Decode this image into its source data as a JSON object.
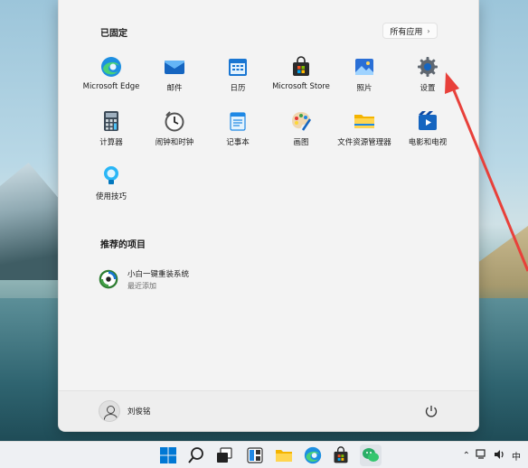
{
  "start_menu": {
    "pinned_title": "已固定",
    "all_apps_label": "所有应用",
    "pinned_apps": [
      {
        "label": "Microsoft Edge",
        "icon": "edge-icon"
      },
      {
        "label": "邮件",
        "icon": "mail-icon"
      },
      {
        "label": "日历",
        "icon": "calendar-icon"
      },
      {
        "label": "Microsoft Store",
        "icon": "store-icon"
      },
      {
        "label": "照片",
        "icon": "photos-icon"
      },
      {
        "label": "设置",
        "icon": "settings-icon"
      },
      {
        "label": "计算器",
        "icon": "calculator-icon"
      },
      {
        "label": "闹钟和时钟",
        "icon": "alarm-clock-icon"
      },
      {
        "label": "记事本",
        "icon": "notepad-icon"
      },
      {
        "label": "画图",
        "icon": "paint-icon"
      },
      {
        "label": "文件资源管理器",
        "icon": "file-explorer-icon"
      },
      {
        "label": "电影和电视",
        "icon": "movies-tv-icon"
      },
      {
        "label": "使用技巧",
        "icon": "tips-icon"
      }
    ],
    "recommended_title": "推荐的项目",
    "recommended": [
      {
        "name": "小白一键重装系统",
        "subtitle": "最近添加"
      }
    ],
    "user_name": "刘俊铭"
  },
  "tray": {
    "ime": "中"
  },
  "colors": {
    "arrow": "#e8403a",
    "accent": "#0067c0"
  }
}
